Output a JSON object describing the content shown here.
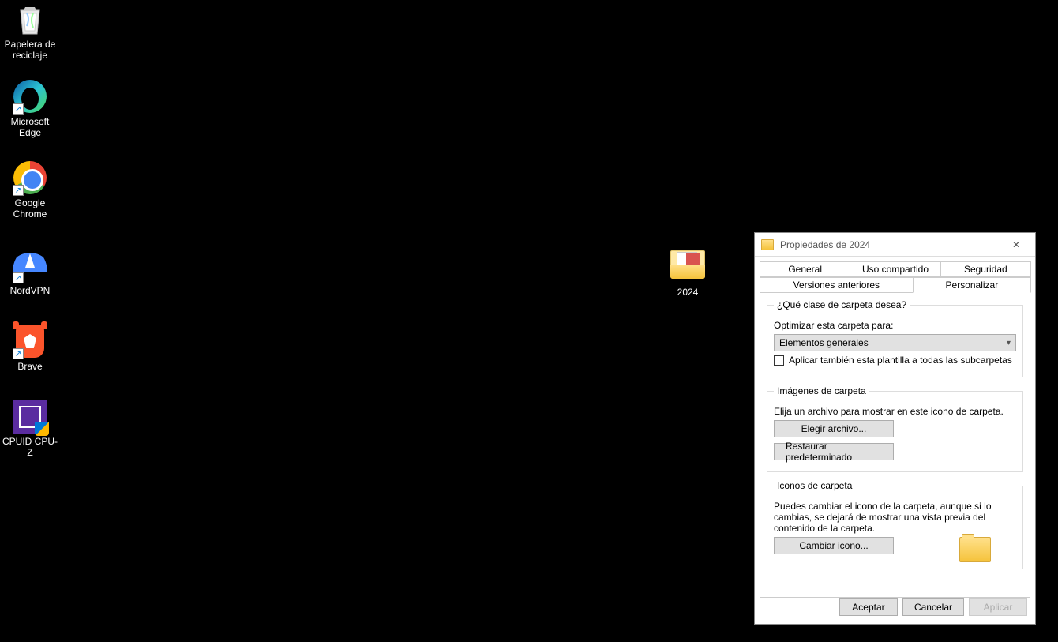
{
  "desktop": {
    "icons": [
      {
        "name": "recycle-bin",
        "label": "Papelera de\nreciclaje"
      },
      {
        "name": "microsoft-edge",
        "label": "Microsoft\nEdge"
      },
      {
        "name": "google-chrome",
        "label": "Google\nChrome"
      },
      {
        "name": "nordvpn",
        "label": "NordVPN"
      },
      {
        "name": "brave",
        "label": "Brave"
      },
      {
        "name": "cpuid-cpuz",
        "label": "CPUID CPU-Z"
      },
      {
        "name": "folder-2024",
        "label": "2024"
      }
    ]
  },
  "dialog": {
    "title": "Propiedades de 2024",
    "tabs": {
      "row1": [
        "General",
        "Uso compartido",
        "Seguridad"
      ],
      "row2": [
        "Versiones anteriores",
        "Personalizar"
      ],
      "active": "Personalizar"
    },
    "group_kind": {
      "legend": "¿Qué clase de carpeta desea?",
      "optimize_label": "Optimizar esta carpeta para:",
      "select_value": "Elementos generales",
      "checkbox_label": "Aplicar también esta plantilla a todas las subcarpetas"
    },
    "group_images": {
      "legend": "Imágenes de carpeta",
      "hint": "Elija un archivo para mostrar en este icono de carpeta.",
      "choose_btn": "Elegir archivo...",
      "restore_btn": "Restaurar predeterminado"
    },
    "group_icons": {
      "legend": "Iconos de carpeta",
      "hint": "Puedes cambiar el icono de la carpeta, aunque si lo cambias, se dejará de mostrar una vista previa del contenido de la carpeta.",
      "change_btn": "Cambiar icono..."
    },
    "buttons": {
      "ok": "Aceptar",
      "cancel": "Cancelar",
      "apply": "Aplicar"
    }
  }
}
